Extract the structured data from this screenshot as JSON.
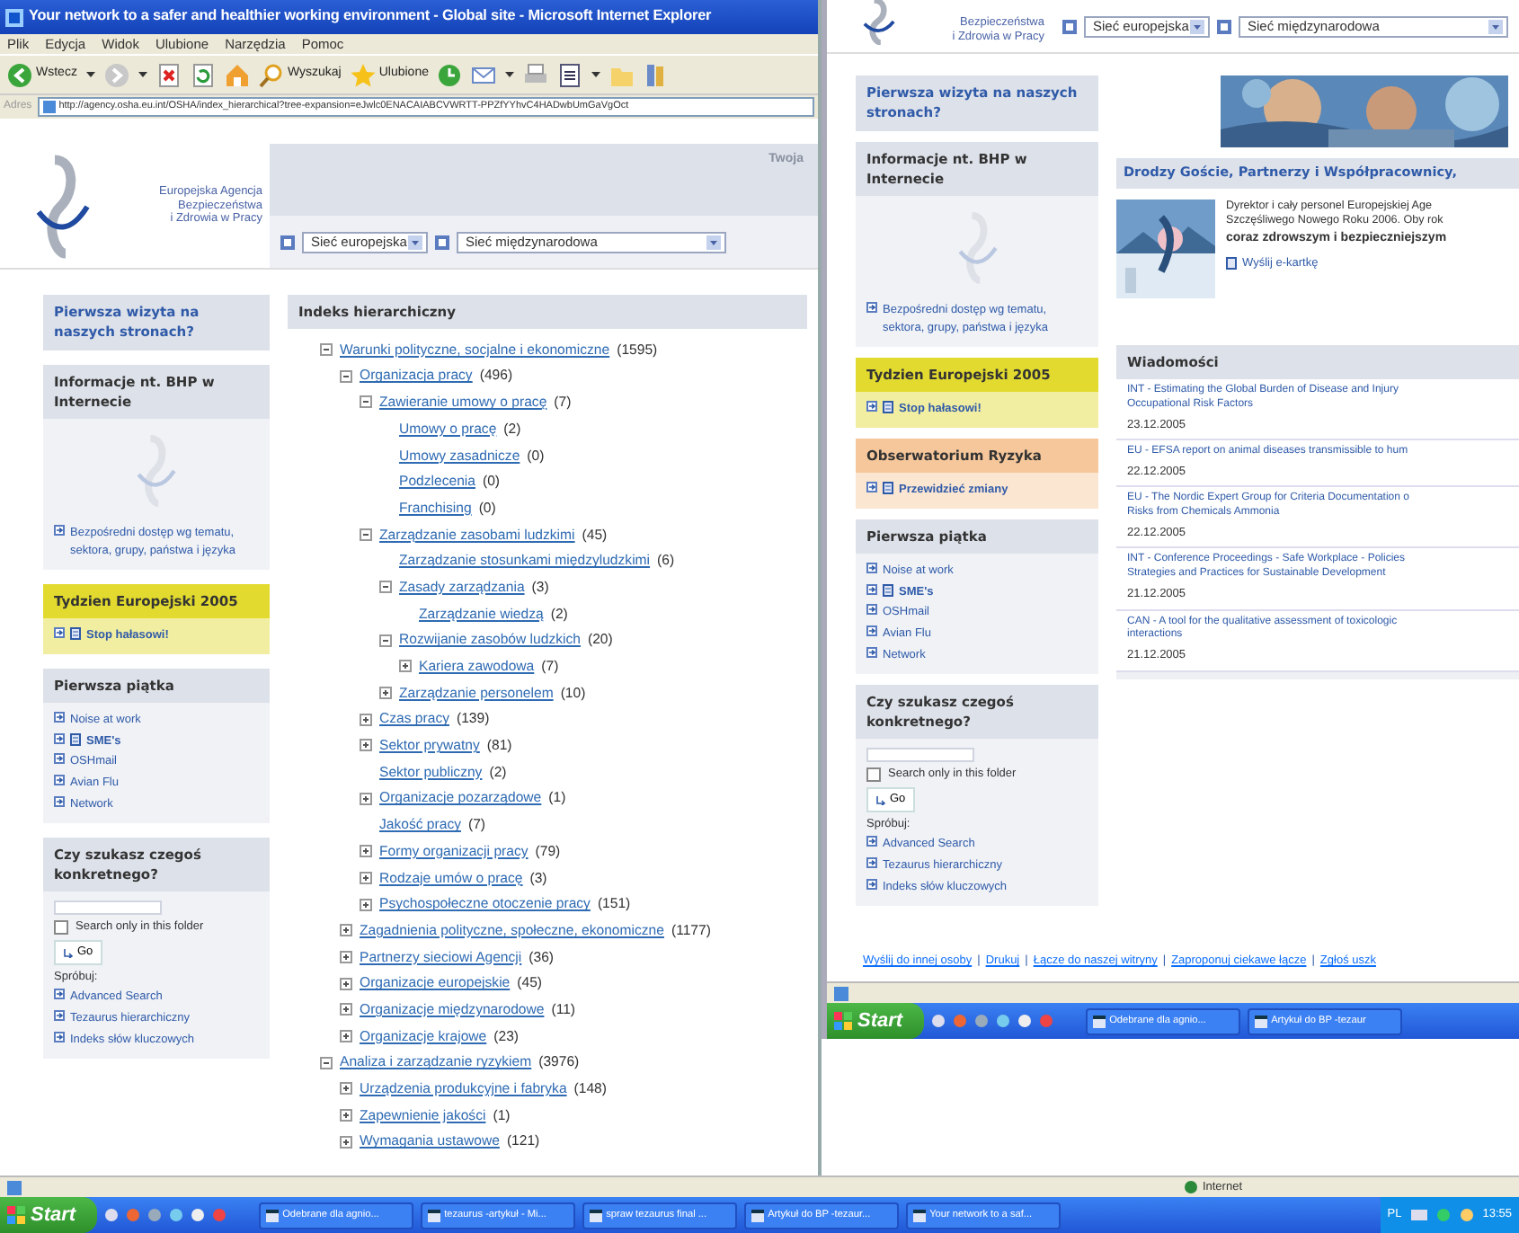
{
  "left_window": {
    "title": "Your network to a safer and healthier working environment - Global site - Microsoft Internet Explorer",
    "menu": [
      "Plik",
      "Edycja",
      "Widok",
      "Ulubione",
      "Narzędzia",
      "Pomoc"
    ],
    "toolbar": [
      {
        "kind": "back",
        "label": "Wstecz",
        "caret": true
      },
      {
        "kind": "forward",
        "caret": true
      },
      {
        "kind": "stop"
      },
      {
        "kind": "refresh"
      },
      {
        "kind": "home"
      },
      {
        "kind": "search",
        "label": "Wyszukaj"
      },
      {
        "kind": "star",
        "label": "Ulubione"
      },
      {
        "kind": "history"
      },
      {
        "kind": "mail",
        "caret": true
      },
      {
        "kind": "print"
      },
      {
        "kind": "word",
        "caret": true
      },
      {
        "kind": "folder"
      },
      {
        "kind": "books"
      }
    ],
    "address_label": "Adres",
    "address": "http://agency.osha.eu.int/OSHA/index_hierarchical?tree-expansion=eJwlc0ENACAIABCVWRTT-PPZfYYhvC4HADwbUmGaVgOct",
    "site_header": {
      "agency": [
        "Europejska Agencja",
        "Bezpieczeństwa",
        "i Zdrowia w Pracy"
      ],
      "top_link": "Twoja",
      "selects": [
        "Sieć europejska",
        "Sieć międzynarodowa"
      ]
    },
    "sidebar": [
      {
        "kind": "intro",
        "color": "#dde1ea",
        "title": "Pierwsza wizyta na naszych stronach?"
      },
      {
        "kind": "info",
        "color": "#dde1ea",
        "title": "Informacje nt. BHP w Internecie",
        "links": [
          {
            "label": "Bezpośredni dostęp wg tematu, sektora, grupy, państwa i języka",
            "doc": false
          }
        ]
      },
      {
        "kind": "links",
        "color": "#e2da2e",
        "title": "Tydzien Europejski 2005",
        "links": [
          {
            "label": "Stop hałasowi!",
            "doc": true
          }
        ]
      },
      {
        "kind": "links",
        "color": "#dde1ea",
        "title": "Pierwsza piątka",
        "links": [
          {
            "label": "Noise at work",
            "doc": false
          },
          {
            "label": "SME's",
            "doc": true
          },
          {
            "label": "OSHmail",
            "doc": false
          },
          {
            "label": "Avian Flu",
            "doc": false
          },
          {
            "label": "Network",
            "doc": false
          }
        ]
      },
      {
        "kind": "search",
        "color": "#dde1ea",
        "title": "Czy szukasz czegoś konkretnego?",
        "checkbox": {
          "label": "Search only in this folder",
          "checked": false
        },
        "button": "Go",
        "hint": "Spróbuj:",
        "links": [
          {
            "label": "Advanced Search",
            "doc": false
          },
          {
            "label": "Tezaurus hierarchiczny",
            "doc": false
          },
          {
            "label": "Indeks słów kluczowych",
            "doc": false
          }
        ]
      }
    ],
    "tree_heading": "Indeks hierarchiczny",
    "tree": [
      {
        "label": "Warunki polityczne, socjalne i ekonomiczne",
        "count": "(1595)",
        "expanded": true,
        "children": [
          {
            "label": "Organizacja pracy",
            "count": "(496)",
            "expanded": true,
            "children": [
              {
                "label": "Zawieranie umowy o pracę",
                "count": "(7)",
                "expanded": true,
                "children": [
                  {
                    "label": "Umowy o pracę",
                    "count": "(2)"
                  },
                  {
                    "label": "Umowy zasadnicze",
                    "count": "(0)"
                  },
                  {
                    "label": "Podzlecenia",
                    "count": "(0)"
                  },
                  {
                    "label": "Franchising",
                    "count": "(0)"
                  }
                ]
              },
              {
                "label": "Zarządzanie zasobami ludzkimi",
                "count": "(45)",
                "expanded": true,
                "children": [
                  {
                    "label": "Zarządzanie stosunkami międzyludzkimi",
                    "count": "(6)"
                  },
                  {
                    "label": "Zasady zarządzania",
                    "count": "(3)",
                    "expanded": true,
                    "children": [
                      {
                        "label": "Zarządzanie wiedzą",
                        "count": "(2)"
                      }
                    ]
                  },
                  {
                    "label": "Rozwijanie zasobów ludzkich",
                    "count": "(20)",
                    "expanded": true,
                    "children": [
                      {
                        "label": "Kariera zawodowa",
                        "count": "(7)",
                        "expanded": false
                      }
                    ]
                  },
                  {
                    "label": "Zarządzanie personelem",
                    "count": "(10)",
                    "expanded": false
                  }
                ]
              },
              {
                "label": "Czas pracy",
                "count": "(139)",
                "expanded": false
              },
              {
                "label": "Sektor prywatny",
                "count": "(81)",
                "expanded": false
              },
              {
                "label": "Sektor publiczny",
                "count": "(2)"
              },
              {
                "label": "Organizacje pozarządowe",
                "count": "(1)",
                "expanded": false
              },
              {
                "label": "Jakość pracy",
                "count": "(7)"
              },
              {
                "label": "Formy organizacji pracy",
                "count": "(79)",
                "expanded": false
              },
              {
                "label": "Rodzaje umów o pracę",
                "count": "(3)",
                "expanded": false
              },
              {
                "label": "Psychospołeczne otoczenie pracy",
                "count": "(151)",
                "expanded": false
              }
            ]
          },
          {
            "label": "Zagadnienia polityczne, społeczne, ekonomiczne",
            "count": "(1177)",
            "expanded": false
          },
          {
            "label": "Partnerzy sieciowi Agencji",
            "count": "(36)",
            "expanded": false
          },
          {
            "label": "Organizacje europejskie",
            "count": "(45)",
            "expanded": false
          },
          {
            "label": "Organizacje międzynarodowe",
            "count": "(11)",
            "expanded": false
          },
          {
            "label": "Organizacje krajowe",
            "count": "(23)",
            "expanded": false
          }
        ]
      },
      {
        "label": "Analiza i zarządzanie ryzykiem",
        "count": "(3976)",
        "expanded": true,
        "children": [
          {
            "label": "Urządzenia produkcyjne i fabryka",
            "count": "(148)",
            "expanded": false
          },
          {
            "label": "Zapewnienie jakości",
            "count": "(1)",
            "expanded": false
          },
          {
            "label": "Wymagania ustawowe",
            "count": "(121)",
            "expanded": false
          }
        ]
      }
    ],
    "status_bar": {
      "zone": "Internet"
    }
  },
  "left_taskbar": {
    "start": "Start",
    "tasks": [
      "Odebrane dla agnio...",
      "tezaurus -artykuł - Mi...",
      "spraw tezaurus final ...",
      "Artykuł do BP -tezaur...",
      "Your network to a saf..."
    ],
    "language": "PL",
    "clock": "13:55"
  },
  "right_window": {
    "site_header": {
      "agency": [
        "Bezpieczeństwa",
        "i Zdrowia w Pracy"
      ],
      "selects": [
        "Sieć europejska",
        "Sieć międzynarodowa"
      ]
    },
    "sidebar": [
      {
        "kind": "intro",
        "color": "#dde1ea",
        "title": "Pierwsza wizyta na naszych stronach?"
      },
      {
        "kind": "info",
        "color": "#dde1ea",
        "title": "Informacje nt. BHP w Internecie",
        "links": [
          {
            "label": "Bezpośredni dostęp wg tematu, sektora, grupy, państwa i języka",
            "doc": false
          }
        ]
      },
      {
        "kind": "links",
        "color": "#e2da2e",
        "title": "Tydzien Europejski 2005",
        "links": [
          {
            "label": "Stop hałasowi!",
            "doc": true
          }
        ]
      },
      {
        "kind": "links",
        "color": "#f6c79a",
        "title": "Obserwatorium Ryzyka",
        "links": [
          {
            "label": "Przewidzieć zmiany",
            "doc": true
          }
        ]
      },
      {
        "kind": "links",
        "color": "#dde1ea",
        "title": "Pierwsza piątka",
        "links": [
          {
            "label": "Noise at work",
            "doc": false
          },
          {
            "label": "SME's",
            "doc": true
          },
          {
            "label": "OSHmail",
            "doc": false
          },
          {
            "label": "Avian Flu",
            "doc": false
          },
          {
            "label": "Network",
            "doc": false
          }
        ]
      },
      {
        "kind": "search",
        "color": "#dde1ea",
        "title": "Czy szukasz czegoś konkretnego?",
        "checkbox": {
          "label": "Search only in this folder",
          "checked": false
        },
        "button": "Go",
        "hint": "Spróbuj:",
        "links": [
          {
            "label": "Advanced Search",
            "doc": false
          },
          {
            "label": "Tezaurus hierarchiczny",
            "doc": false
          },
          {
            "label": "Indeks słów kluczowych",
            "doc": false
          }
        ]
      }
    ],
    "welcome": "Drodzy Goście, Partnerzy i Współpracownicy,",
    "greeting": [
      "Dyrektor i cały personel Europejskiej Age",
      "Szczęśliwego Nowego Roku 2006. Oby rok"
    ],
    "greeting_bold": "coraz zdrowszym i bezpieczniejszym",
    "ecard": "Wyślij e-kartkę",
    "news_heading": "Wiadomości",
    "news": [
      {
        "lines": [
          "INT - Estimating the Global Burden of Disease and Injury",
          "Occupational Risk Factors"
        ],
        "date": "23.12.2005"
      },
      {
        "lines": [
          "EU - EFSA report on animal diseases transmissible to hum"
        ],
        "date": "22.12.2005"
      },
      {
        "lines": [
          "EU - The Nordic Expert Group for Criteria Documentation o",
          "Risks from Chemicals Ammonia"
        ],
        "date": "22.12.2005"
      },
      {
        "lines": [
          "INT - Conference Proceedings - Safe Workplace - Policies",
          "Strategies and Practices for Sustainable Development"
        ],
        "date": "21.12.2005"
      },
      {
        "lines": [
          "CAN - A tool for the qualitative assessment of toxicologic",
          "interactions"
        ],
        "date": "21.12.2005"
      }
    ],
    "footer_links": [
      "Wyślij do innej osoby",
      "Drukuj",
      "Łącze do naszej witryny",
      "Zaproponuj ciekawe łącze",
      "Zgłoś uszk"
    ],
    "footer_separator": "|"
  },
  "right_taskbar": {
    "start": "Start",
    "tasks": [
      "Odebrane dla agnio...",
      "Artykuł do BP -tezaur"
    ]
  }
}
